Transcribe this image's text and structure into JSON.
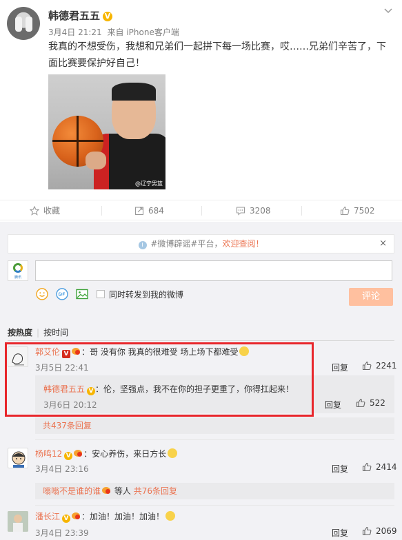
{
  "post": {
    "author": "韩德君五五",
    "verified_mark": "V",
    "date": "3月4日 21:21",
    "source": "来自 iPhone客户端",
    "text": "我真的不想受伤，我想和兄弟们一起拼下每一场比赛，哎……兄弟们辛苦了，下面比赛要保护好自己！",
    "image_watermark": "@辽宁男篮"
  },
  "actions": {
    "favorite_label": "收藏",
    "repost_count": "684",
    "comment_count": "3208",
    "like_count": "7502"
  },
  "notice": {
    "prefix": "#微博辟谣#平台，",
    "link": "欢迎查阅！",
    "close": "×"
  },
  "composer": {
    "brand": "腾讯",
    "sync_label": "同时转发到我的微博",
    "submit_label": "评论"
  },
  "sort": {
    "hot": "按热度",
    "time": "按时间"
  },
  "comments": [
    {
      "name": "郭艾伦",
      "text": "：哥 没有你 我真的很难受 场上场下都难受",
      "time": "3月5日 22:41",
      "reply_label": "回复",
      "likes": "2241",
      "sub_reply": {
        "name": "韩德君五五",
        "text": "：伦，坚强点，我不在你的担子更重了，你得扛起来！",
        "time": "3月6日 20:12",
        "reply_label": "回复",
        "likes": "522"
      },
      "more": "共437条回复"
    },
    {
      "name": "杨鸣12",
      "text": "：安心养伤，来日方长",
      "time": "3月4日 23:16",
      "reply_label": "回复",
      "likes": "2414",
      "more_user": "嗡嗡不是谁的谁",
      "more_mid": "等人",
      "more": "共76条回复"
    },
    {
      "name": "潘长江",
      "text": "：加油！加油！加油！",
      "time": "3月4日 23:39",
      "reply_label": "回复",
      "likes": "2069"
    }
  ],
  "colors": {
    "accent": "#eb7350",
    "highlight_border": "#e8262b",
    "submit_bg": "#ffc09f"
  }
}
